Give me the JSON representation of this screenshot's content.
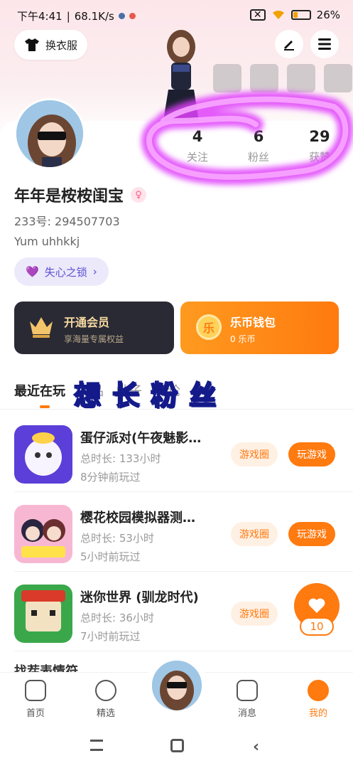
{
  "status_bar": {
    "time": "下午4:41",
    "speed": "68.1K/s",
    "battery": "26%"
  },
  "header": {
    "outfit_label": "换衣服"
  },
  "profile": {
    "name": "年年是桉桉闺宝",
    "uid": "233号: 294507703",
    "bio": "Yum uhhkkj",
    "tag": "失心之锁",
    "stats": [
      {
        "value": "4",
        "label": "关注"
      },
      {
        "value": "6",
        "label": "粉丝"
      },
      {
        "value": "29",
        "label": "获赞"
      }
    ]
  },
  "vip_card": {
    "title": "开通会员",
    "subtitle": "享海量专属权益"
  },
  "wallet_card": {
    "title": "乐币钱包",
    "subtitle": "0 乐币",
    "icon_char": "乐"
  },
  "tabs": [
    "最近在玩",
    "作品",
    "帖子",
    "评论"
  ],
  "overlay_text": "想长粉丝",
  "games": [
    {
      "title": "蛋仔派对(午夜魅影…",
      "duration": "总时长: 133小时",
      "last_played": "8分钟前玩过",
      "btn_circle": "游戏圈",
      "btn_play": "玩游戏"
    },
    {
      "title": "樱花校园模拟器测…",
      "duration": "总时长: 53小时",
      "last_played": "5小时前玩过",
      "btn_circle": "游戏圈",
      "btn_play": "玩游戏"
    },
    {
      "title": "迷你世界 (驯龙时代)",
      "duration": "总时长: 36小时",
      "last_played": "7小时前玩过",
      "btn_circle": "游戏圈"
    }
  ],
  "partial_row_text": "找茬表情符",
  "float_like_count": "10",
  "nav": [
    {
      "label": "首页"
    },
    {
      "label": "精选"
    },
    {
      "label": "消息"
    },
    {
      "label": "我的"
    }
  ],
  "colors": {
    "accent": "#ff7a0f",
    "vip_bg": "#2a2a34",
    "highlight": "#e040fb"
  }
}
